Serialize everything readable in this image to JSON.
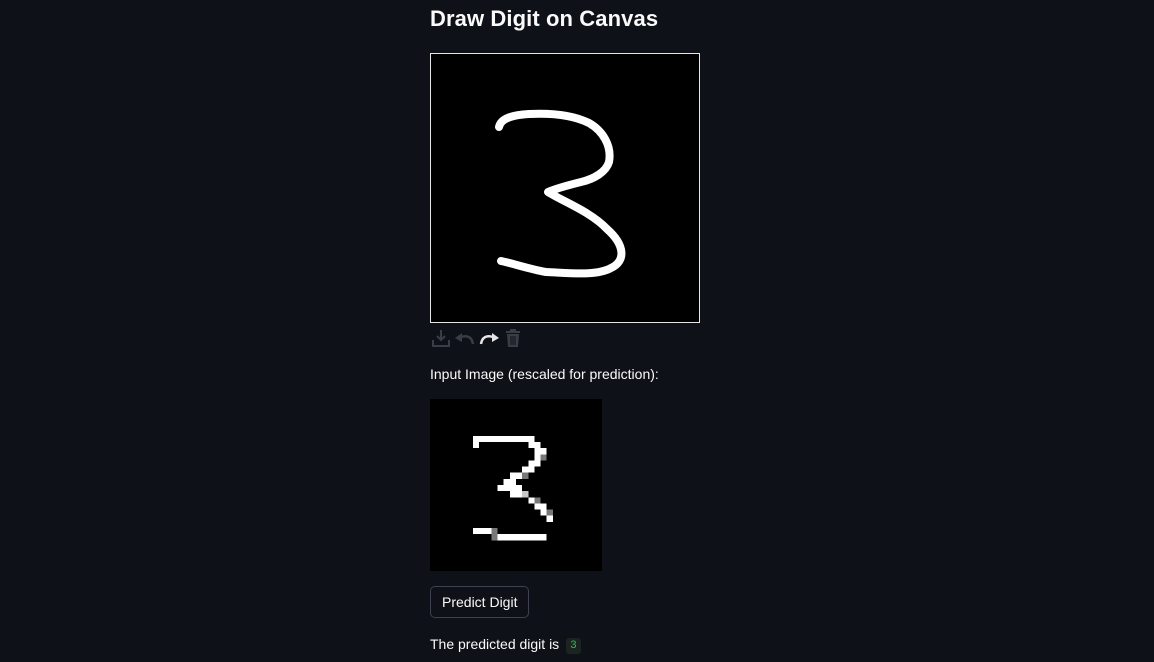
{
  "page": {
    "title": "Draw Digit on Canvas"
  },
  "canvas": {
    "background_color": "#000000",
    "stroke_color": "#ffffff",
    "drawn_digit": "3"
  },
  "toolbar": {
    "buttons": [
      {
        "name": "download",
        "icon": "download-icon"
      },
      {
        "name": "undo",
        "icon": "undo-icon"
      },
      {
        "name": "redo",
        "icon": "redo-icon"
      },
      {
        "name": "delete",
        "icon": "trash-icon"
      }
    ]
  },
  "preview": {
    "caption": "Input Image (rescaled for prediction):",
    "grid_size": 28
  },
  "actions": {
    "predict_label": "Predict Digit"
  },
  "result": {
    "text": "The predicted digit is",
    "value": "3"
  },
  "colors": {
    "app_background": "#0e1117",
    "text": "#fafafa",
    "code_text": "#21c354",
    "button_border": "#3d4150"
  }
}
